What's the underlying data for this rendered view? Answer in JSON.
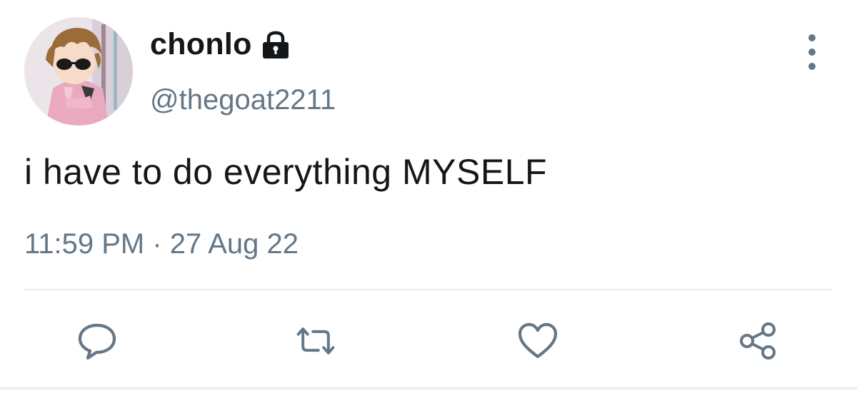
{
  "user": {
    "display_name": "chonlo",
    "handle": "@thegoat2211",
    "protected_icon": "lock-icon",
    "avatar": "avatar-image"
  },
  "tweet": {
    "text": "i have to do everything MYSELF",
    "timestamp": "11:59 PM · 27 Aug 22"
  },
  "actions": [
    {
      "name": "reply",
      "icon": "comment-icon"
    },
    {
      "name": "retweet",
      "icon": "retweet-icon"
    },
    {
      "name": "like",
      "icon": "heart-icon"
    },
    {
      "name": "share",
      "icon": "share-icon"
    }
  ],
  "menu_icon": "more-options-icon",
  "colors": {
    "text_primary": "#14171a",
    "text_secondary": "#657786",
    "divider": "#e6ecf0"
  }
}
